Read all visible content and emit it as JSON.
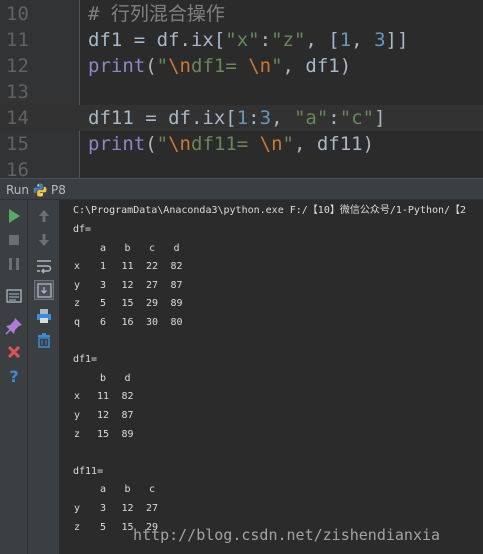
{
  "editor": {
    "lines": [
      {
        "number": "10",
        "tokens": [
          {
            "t": "# 行列混合操作",
            "c": "comment"
          }
        ]
      },
      {
        "number": "11",
        "tokens": [
          {
            "t": "df1 = df.ix[",
            "c": "plain"
          },
          {
            "t": "\"x\"",
            "c": "string"
          },
          {
            "t": ":",
            "c": "plain"
          },
          {
            "t": "\"z\"",
            "c": "string"
          },
          {
            "t": ", [",
            "c": "plain"
          },
          {
            "t": "1",
            "c": "number"
          },
          {
            "t": ", ",
            "c": "plain"
          },
          {
            "t": "3",
            "c": "number"
          },
          {
            "t": "]]",
            "c": "plain"
          }
        ]
      },
      {
        "number": "12",
        "tokens": [
          {
            "t": "print",
            "c": "builtin"
          },
          {
            "t": "(",
            "c": "plain"
          },
          {
            "t": "\"",
            "c": "string"
          },
          {
            "t": "\\n",
            "c": "escape"
          },
          {
            "t": "df1= ",
            "c": "string"
          },
          {
            "t": "\\n",
            "c": "escape"
          },
          {
            "t": "\"",
            "c": "string"
          },
          {
            "t": ", df1)",
            "c": "plain"
          }
        ]
      },
      {
        "number": "13",
        "tokens": []
      },
      {
        "number": "14",
        "tokens": [
          {
            "t": "df11 = df.ix[",
            "c": "plain"
          },
          {
            "t": "1",
            "c": "number"
          },
          {
            "t": ":",
            "c": "plain"
          },
          {
            "t": "3",
            "c": "number"
          },
          {
            "t": ", ",
            "c": "plain"
          },
          {
            "t": "\"a\"",
            "c": "string"
          },
          {
            "t": ":",
            "c": "plain"
          },
          {
            "t": "\"c\"",
            "c": "string"
          },
          {
            "t": "]",
            "c": "plain"
          }
        ],
        "current": true
      },
      {
        "number": "15",
        "tokens": [
          {
            "t": "print",
            "c": "builtin"
          },
          {
            "t": "(",
            "c": "plain"
          },
          {
            "t": "\"",
            "c": "string"
          },
          {
            "t": "\\n",
            "c": "escape"
          },
          {
            "t": "df11= ",
            "c": "string"
          },
          {
            "t": "\\n",
            "c": "escape"
          },
          {
            "t": "\"",
            "c": "string"
          },
          {
            "t": ", df11)",
            "c": "plain"
          }
        ]
      },
      {
        "number": "16",
        "tokens": []
      }
    ]
  },
  "run_panel": {
    "tab_label": "Run",
    "config_name": "P8",
    "toolbar_left": [
      "run-icon",
      "stop-icon",
      "pause-icon",
      "dump-threads-icon",
      "pin-icon",
      "close-icon",
      "help-icon"
    ],
    "toolbar_right": [
      "up-arrow-icon",
      "down-arrow-icon",
      "soft-wrap-icon",
      "scroll-to-end-icon",
      "print-icon",
      "trash-icon"
    ]
  },
  "console": {
    "command": "C:\\ProgramData\\Anaconda3\\python.exe F:/【10】微信公众号/1-Python/【2",
    "blocks": [
      {
        "title": "df=",
        "columns": [
          "a",
          "b",
          "c",
          "d"
        ],
        "rows": [
          {
            "index": "x",
            "values": [
              "1",
              "11",
              "22",
              "82"
            ]
          },
          {
            "index": "y",
            "values": [
              "3",
              "12",
              "27",
              "87"
            ]
          },
          {
            "index": "z",
            "values": [
              "5",
              "15",
              "29",
              "89"
            ]
          },
          {
            "index": "q",
            "values": [
              "6",
              "16",
              "30",
              "80"
            ]
          }
        ]
      },
      {
        "title": "df1=",
        "columns": [
          "b",
          "d"
        ],
        "rows": [
          {
            "index": "x",
            "values": [
              "11",
              "82"
            ]
          },
          {
            "index": "y",
            "values": [
              "12",
              "87"
            ]
          },
          {
            "index": "z",
            "values": [
              "15",
              "89"
            ]
          }
        ]
      },
      {
        "title": "df11=",
        "columns": [
          "a",
          "b",
          "c"
        ],
        "rows": [
          {
            "index": "y",
            "values": [
              "3",
              "12",
              "27"
            ]
          },
          {
            "index": "z",
            "values": [
              "5",
              "15",
              "29"
            ]
          }
        ]
      }
    ]
  },
  "watermark": "http://blog.csdn.net/zishendianxia"
}
